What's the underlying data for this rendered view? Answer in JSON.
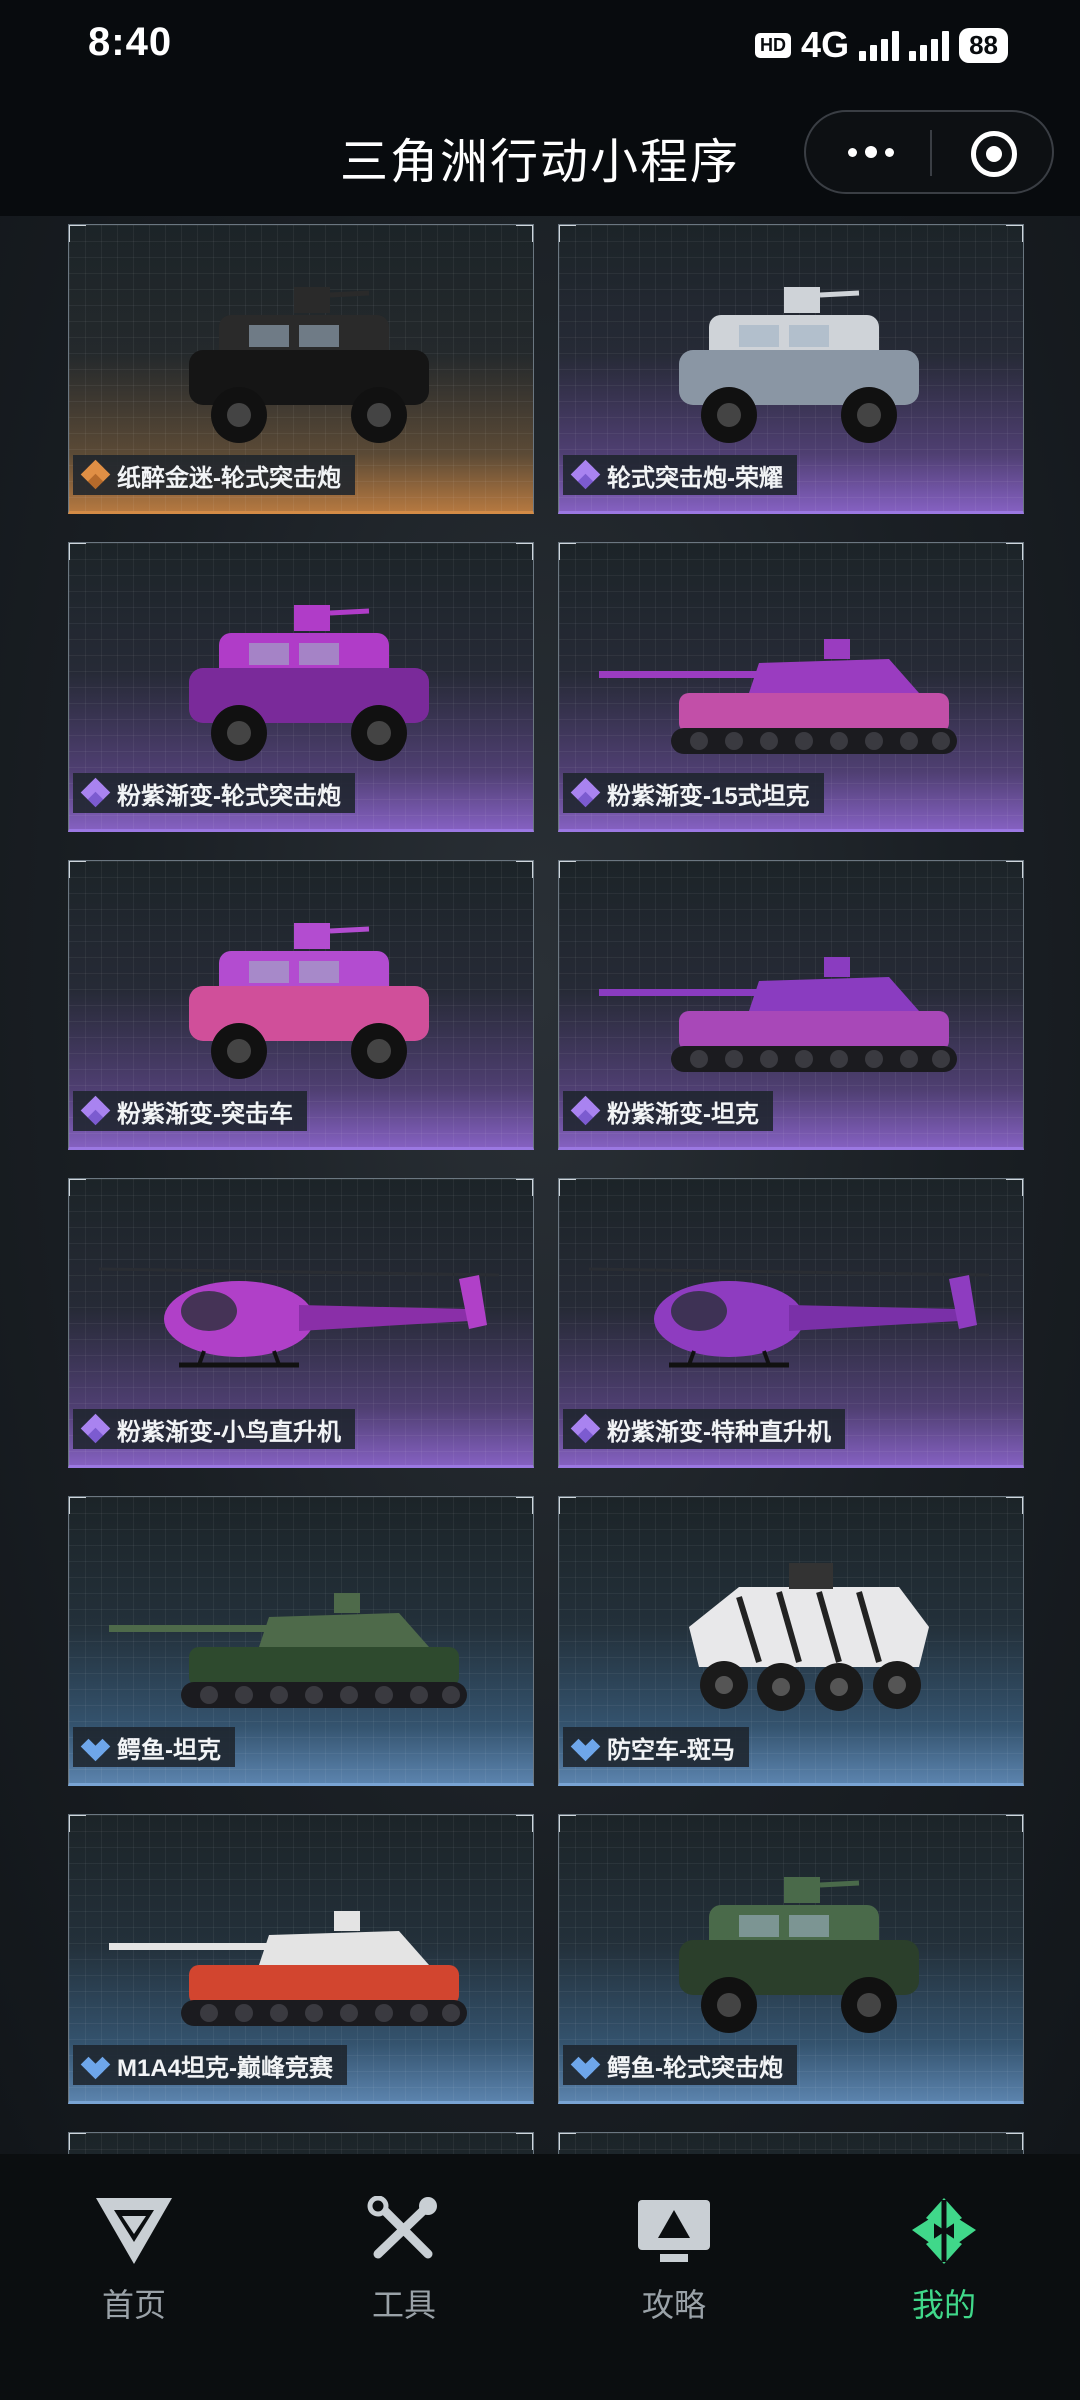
{
  "status_bar": {
    "time": "8:40",
    "hd": "HD",
    "network": "4G",
    "battery": "88"
  },
  "title_bar": {
    "title": "三角洲行动小程序"
  },
  "colors": {
    "gold": "#d38b46",
    "purple": "#9b78e2",
    "blue": "#79a4d4",
    "active_tab": "#40d88a"
  },
  "items": [
    {
      "label": "纸醉金迷-轮式突击炮",
      "rarity": "gold",
      "vehicle": "armored-car"
    },
    {
      "label": "轮式突击炮-荣耀",
      "rarity": "purple",
      "vehicle": "armored-car"
    },
    {
      "label": "粉紫渐变-轮式突击炮",
      "rarity": "purple",
      "vehicle": "armored-car"
    },
    {
      "label": "粉紫渐变-15式坦克",
      "rarity": "purple",
      "vehicle": "tank"
    },
    {
      "label": "粉紫渐变-突击车",
      "rarity": "purple",
      "vehicle": "armored-car"
    },
    {
      "label": "粉紫渐变-坦克",
      "rarity": "purple",
      "vehicle": "tank"
    },
    {
      "label": "粉紫渐变-小鸟直升机",
      "rarity": "purple",
      "vehicle": "helicopter"
    },
    {
      "label": "粉紫渐变-特种直升机",
      "rarity": "purple",
      "vehicle": "helicopter"
    },
    {
      "label": "鳄鱼-坦克",
      "rarity": "blue",
      "vehicle": "tank"
    },
    {
      "label": "防空车-斑马",
      "rarity": "blue",
      "vehicle": "apc"
    },
    {
      "label": "M1A4坦克-巅峰竞赛",
      "rarity": "blue",
      "vehicle": "tank"
    },
    {
      "label": "鳄鱼-轮式突击炮",
      "rarity": "blue",
      "vehicle": "armored-car"
    }
  ],
  "tabs": [
    {
      "label": "首页",
      "icon": "delta-logo-icon",
      "active": false
    },
    {
      "label": "工具",
      "icon": "tools-icon",
      "active": false
    },
    {
      "label": "攻略",
      "icon": "guide-monitor-icon",
      "active": false
    },
    {
      "label": "我的",
      "icon": "profile-logo-icon",
      "active": true
    }
  ]
}
